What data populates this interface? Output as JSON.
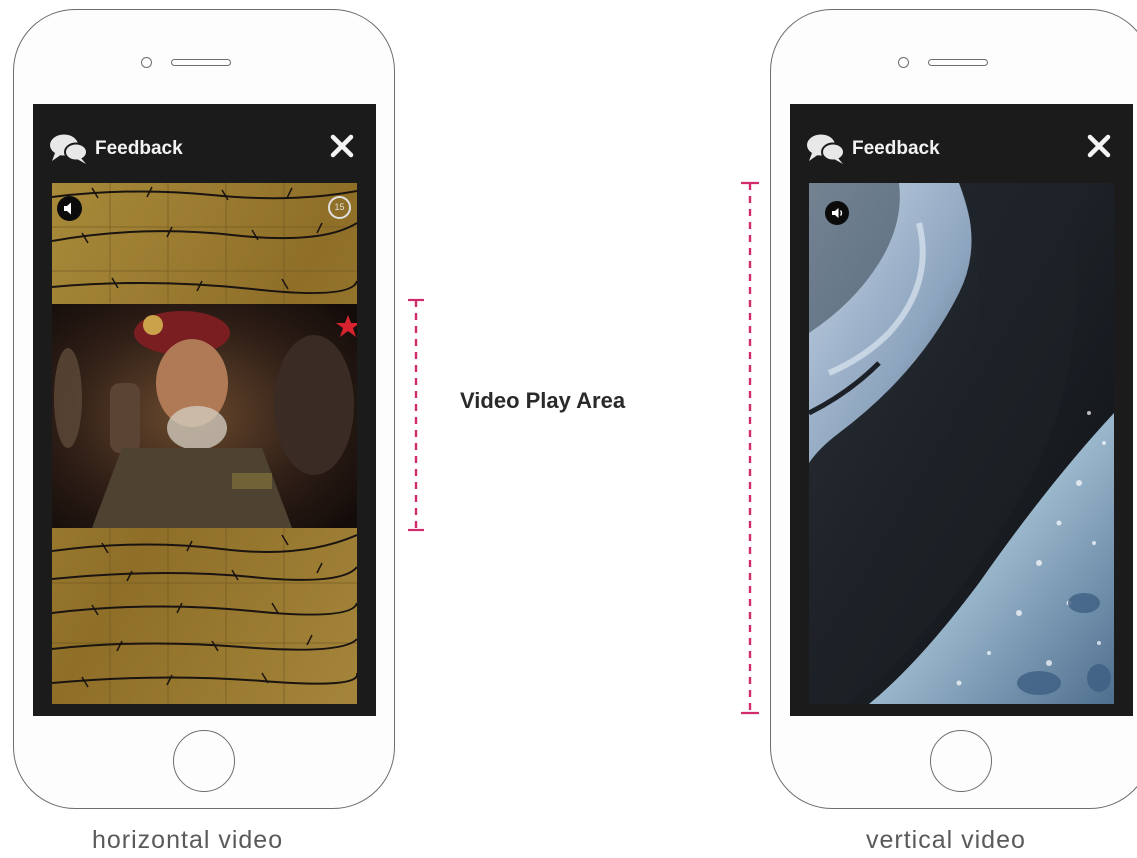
{
  "annotation": {
    "label": "Video Play Area",
    "color": "#d02b6b"
  },
  "phones": [
    {
      "header": {
        "title": "Feedback"
      },
      "caption": "horizontal video",
      "video": {
        "timer": "15"
      }
    },
    {
      "header": {
        "title": "Feedback"
      },
      "caption": "vertical video"
    }
  ],
  "icons": [
    "chat-bubbles-icon",
    "close-icon",
    "speaker-icon",
    "countdown-timer-icon"
  ]
}
